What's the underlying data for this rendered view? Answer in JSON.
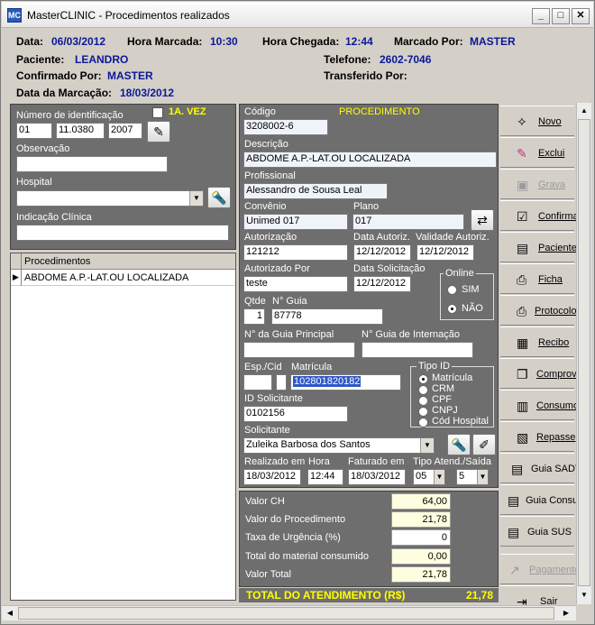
{
  "window": {
    "title": "MasterCLINIC - Procedimentos realizados",
    "app_icon": "MC"
  },
  "header": {
    "data_lbl": "Data:",
    "data_val": "06/03/2012",
    "hora_lbl": "Hora Marcada:",
    "hora_val": "10:30",
    "chegada_lbl": "Hora Chegada:",
    "chegada_val": "12:44",
    "marcado_lbl": "Marcado Por:",
    "marcado_val": "MASTER",
    "paciente_lbl": "Paciente:",
    "paciente_val": "LEANDRO",
    "telefone_lbl": "Telefone:",
    "telefone_val": "2602-7046",
    "confirmado_lbl": "Confirmado Por:",
    "confirmado_val": "MASTER",
    "transferido_lbl": "Transferido Por:",
    "datamarc_lbl": "Data da Marcação:",
    "datamarc_val": "18/03/2012"
  },
  "left": {
    "numero_lbl": "Número de identificação",
    "vez_lbl": "1A. VEZ",
    "id1": "01",
    "id2": "11.0380",
    "id3": "2007",
    "observacao_lbl": "Observação",
    "observacao_val": "",
    "hospital_lbl": "Hospital",
    "hospital_val": "",
    "indicacao_lbl": "Indicação Clínica",
    "indicacao_val": ""
  },
  "grid": {
    "header": "Procedimentos",
    "rows": [
      "ABDOME A.P.-LAT.OU LOCALIZADA"
    ]
  },
  "proc": {
    "codigo_lbl": "Código",
    "codigo_val": "3208002-6",
    "tipo_lbl": "PROCEDIMENTO",
    "descricao_lbl": "Descrição",
    "descricao_val": "ABDOME A.P.-LAT.OU LOCALIZADA",
    "profissional_lbl": "Profissional",
    "profissional_val": "Alessandro de Sousa Leal",
    "convenio_lbl": "Convênio",
    "convenio_val": "Unimed 017",
    "plano_lbl": "Plano",
    "plano_val": "017",
    "autorizacao_lbl": "Autorização",
    "autorizacao_val": "121212",
    "dataaut_lbl": "Data Autoriz.",
    "dataaut_val": "12/12/2012",
    "validade_lbl": "Validade Autoriz.",
    "validade_val": "12/12/2012",
    "autorizadopor_lbl": "Autorizado Por",
    "autorizadopor_val": "teste",
    "datasol_lbl": "Data Solicitação",
    "datasol_val": "12/12/2012",
    "online_lbl": "Online",
    "sim_lbl": "SIM",
    "nao_lbl": "NÃO",
    "qtde_lbl": "Qtde",
    "qtde_val": "1",
    "guia_lbl": "N° Guia",
    "guia_val": "87778",
    "guiaprinc_lbl": "N° da Guia Principal",
    "guiaprinc_val": "",
    "guiaint_lbl": "N° Guia de Internação",
    "guiaint_val": "",
    "espcid_lbl": "Esp./Cid",
    "matricula_lbl": "Matrícula",
    "matricula_val": "102801820182",
    "tipoid_lbl": "Tipo ID",
    "tipoid_opts": [
      "Matrícula",
      "CRM",
      "CPF",
      "CNPJ",
      "Cód Hospital"
    ],
    "idsol_lbl": "ID Solicitante",
    "idsol_val": "0102156",
    "solicitante_lbl": "Solicitante",
    "solicitante_val": "Zuleika Barbosa dos Santos",
    "realizado_lbl": "Realizado em",
    "realizado_val": "18/03/2012",
    "hora_lbl": "Hora",
    "hora_val": "12:44",
    "faturado_lbl": "Faturado em",
    "faturado_val": "18/03/2012",
    "tipoatend_lbl": "Tipo Atend./Saída",
    "tipoatend_val": "05",
    "saida_val": "5"
  },
  "totals": {
    "ch_lbl": "Valor CH",
    "ch_val": "64,00",
    "proc_lbl": "Valor do Procedimento",
    "proc_val": "21,78",
    "urg_lbl": "Taxa de Urgência (%)",
    "urg_val": "0",
    "mat_lbl": "Total do material consumido",
    "mat_val": "0,00",
    "total_lbl": "Valor Total",
    "total_val": "21,78",
    "grand_lbl": "TOTAL DO ATENDIMENTO (R$)",
    "grand_val": "21,78"
  },
  "sidebar": [
    {
      "label": "Novo",
      "icon": "sparkle-icon"
    },
    {
      "label": "Exclui",
      "icon": "eraser-icon"
    },
    {
      "label": "Grava",
      "icon": "floppy-icon"
    },
    {
      "label": "Confirma",
      "icon": "check-icon"
    },
    {
      "label": "Paciente",
      "icon": "document-icon"
    },
    {
      "label": "Ficha",
      "icon": "printer-icon"
    },
    {
      "label": "Protocolo",
      "icon": "printer-icon"
    },
    {
      "label": "Recibo",
      "icon": "receipt-icon"
    },
    {
      "label": "Comprov",
      "icon": "copy-icon"
    },
    {
      "label": "Consumo",
      "icon": "barcode-icon"
    },
    {
      "label": "Repasse",
      "icon": "books-icon"
    },
    {
      "label": "Guia SADT",
      "icon": "document-icon"
    },
    {
      "label": "Guia Consulta",
      "icon": "document-icon"
    },
    {
      "label": "Guia SUS",
      "icon": "document-icon"
    },
    {
      "label": "Pagamento",
      "icon": "payment-icon"
    },
    {
      "label": "Sair",
      "icon": "exit-icon"
    }
  ],
  "colors": {
    "accent_blue": "#0a1896",
    "highlight_yellow": "#ffff00",
    "panel_gray": "#6e6e6e"
  }
}
